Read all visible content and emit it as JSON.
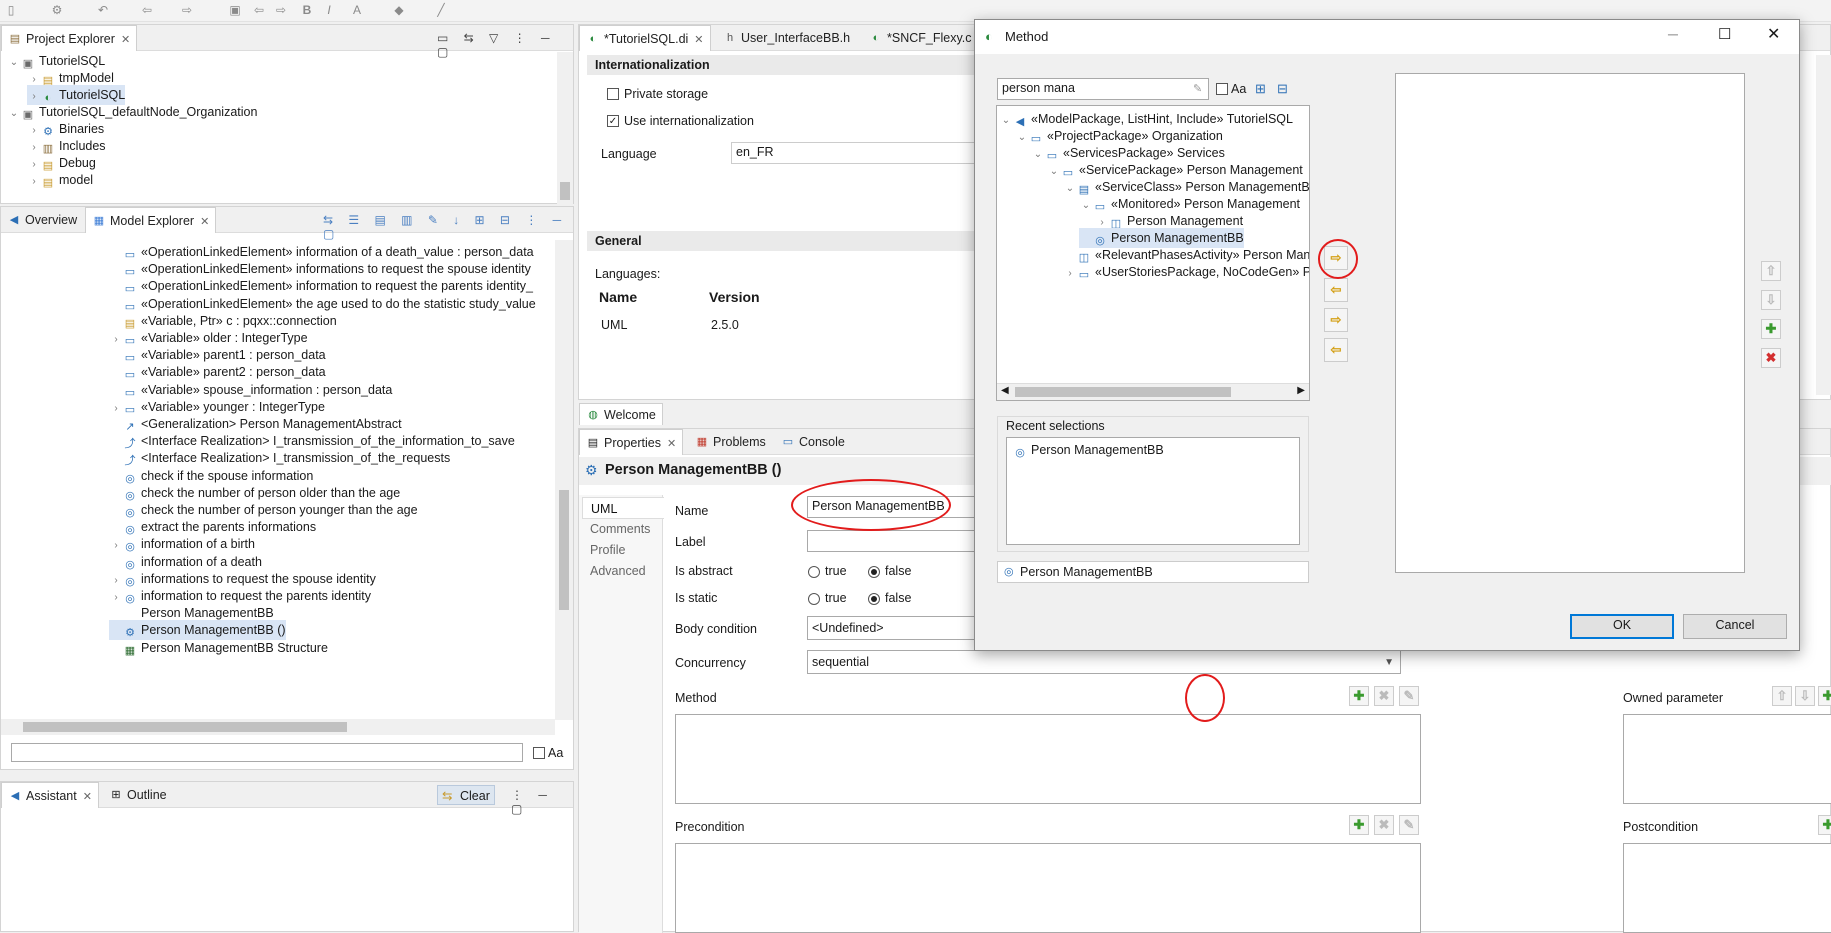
{
  "project_explorer": {
    "tab_label": "Project Explorer",
    "tree": [
      {
        "label": "TutorielSQL",
        "depth": 0,
        "twisty": "expanded",
        "icon": "project-icon"
      },
      {
        "label": "tmpModel",
        "depth": 1,
        "twisty": "collapsed",
        "icon": "folder-icon"
      },
      {
        "label": "TutorielSQL",
        "depth": 1,
        "twisty": "collapsed",
        "icon": "model-icon",
        "selected": true
      },
      {
        "label": "TutorielSQL_defaultNode_Organization",
        "depth": 0,
        "twisty": "expanded",
        "icon": "project-icon"
      },
      {
        "label": "Binaries",
        "depth": 1,
        "twisty": "collapsed",
        "icon": "binaries-icon"
      },
      {
        "label": "Includes",
        "depth": 1,
        "twisty": "collapsed",
        "icon": "includes-icon"
      },
      {
        "label": "Debug",
        "depth": 1,
        "twisty": "collapsed",
        "icon": "folder-icon"
      },
      {
        "label": "model",
        "depth": 1,
        "twisty": "collapsed",
        "icon": "folder-icon"
      }
    ]
  },
  "model_explorer": {
    "tabs": [
      "Overview",
      "Model Explorer"
    ],
    "filter_placeholder": "",
    "match_case_label": "Aa",
    "items": [
      {
        "label": "«OperationLinkedElement» information of a death_value : person_data",
        "icon": "operation-icon",
        "twisty": ""
      },
      {
        "label": "«OperationLinkedElement» informations to request the spouse identity",
        "icon": "operation-icon",
        "twisty": ""
      },
      {
        "label": "«OperationLinkedElement» information to request the parents identity_",
        "icon": "operation-icon",
        "twisty": ""
      },
      {
        "label": "«OperationLinkedElement» the age used to do the statistic study_value",
        "icon": "operation-icon",
        "twisty": ""
      },
      {
        "label": "«Variable, Ptr» c : pqxx::connection",
        "icon": "variable-icon",
        "twisty": ""
      },
      {
        "label": "«Variable» older : IntegerType",
        "icon": "operation-icon",
        "twisty": "collapsed"
      },
      {
        "label": "«Variable» parent1 : person_data",
        "icon": "operation-icon",
        "twisty": ""
      },
      {
        "label": "«Variable» parent2 : person_data",
        "icon": "operation-icon",
        "twisty": ""
      },
      {
        "label": "«Variable» spouse_information : person_data",
        "icon": "operation-icon",
        "twisty": ""
      },
      {
        "label": "«Variable» younger : IntegerType",
        "icon": "operation-icon",
        "twisty": "collapsed"
      },
      {
        "label": "<Generalization> Person ManagementAbstract",
        "icon": "generalization-icon",
        "twisty": ""
      },
      {
        "label": "<Interface Realization> I_transmission_of_the_information_to_save",
        "icon": "realization-icon",
        "twisty": ""
      },
      {
        "label": "<Interface Realization> I_transmission_of_the_requests",
        "icon": "realization-icon",
        "twisty": ""
      },
      {
        "label": "check if the spouse information",
        "icon": "behavior-icon",
        "twisty": ""
      },
      {
        "label": "check the number of person older than the age",
        "icon": "behavior-icon",
        "twisty": ""
      },
      {
        "label": "check the number of person younger than the age",
        "icon": "behavior-icon",
        "twisty": ""
      },
      {
        "label": "extract the parents informations",
        "icon": "behavior-icon",
        "twisty": ""
      },
      {
        "label": "information of a birth",
        "icon": "behavior-icon",
        "twisty": "collapsed"
      },
      {
        "label": "information of a death",
        "icon": "behavior-icon",
        "twisty": ""
      },
      {
        "label": "informations to request the spouse identity",
        "icon": "behavior-icon",
        "twisty": "collapsed"
      },
      {
        "label": "information to request the parents identity",
        "icon": "behavior-icon",
        "twisty": "collapsed"
      },
      {
        "label": "Person ManagementBB",
        "icon": "none",
        "twisty": ""
      },
      {
        "label": "Person ManagementBB ()",
        "icon": "operation-gear-icon",
        "twisty": "",
        "selected": true
      },
      {
        "label": "Person ManagementBB Structure",
        "icon": "structure-icon",
        "twisty": ""
      }
    ]
  },
  "assistant": {
    "tabs": [
      "Assistant",
      "Outline"
    ],
    "clear_label": "Clear"
  },
  "editor": {
    "tabs": [
      "*TutorielSQL.di",
      "User_InterfaceBB.h",
      "*SNCF_Flexy.c"
    ],
    "internationalization_header": "Internationalization",
    "private_storage_label": "Private storage",
    "use_i18n_label": "Use internationalization",
    "language_label": "Language",
    "language_value": "en_FR",
    "general_header": "General",
    "languages_label": "Languages:",
    "table_headers": [
      "Name",
      "Version"
    ],
    "table_rows": [
      [
        "UML",
        "2.5.0"
      ]
    ],
    "welcome_tab": "Welcome"
  },
  "properties": {
    "tabs": [
      "Properties",
      "Problems",
      "Console"
    ],
    "title": "Person ManagementBB ()",
    "side_tabs": [
      "UML",
      "Comments",
      "Profile",
      "Advanced"
    ],
    "name_label": "Name",
    "name_value": "Person ManagementBB",
    "label_label": "Label",
    "label_value": "",
    "is_abstract_label": "Is abstract",
    "is_static_label": "Is static",
    "true_label": "true",
    "false_label": "false",
    "body_condition_label": "Body condition",
    "body_condition_value": "<Undefined>",
    "concurrency_label": "Concurrency",
    "concurrency_value": "sequential",
    "method_label": "Method",
    "owned_parameter_label": "Owned parameter",
    "precondition_label": "Precondition",
    "postcondition_label": "Postcondition"
  },
  "dialog": {
    "title": "Method",
    "search_value": "person mana",
    "match_case_label": "Aa",
    "tree": [
      {
        "label": "«ModelPackage, ListHint, Include» TutorielSQL",
        "depth": 0,
        "twisty": "expanded",
        "icon": "model-package-icon"
      },
      {
        "label": "«ProjectPackage» Organization",
        "depth": 1,
        "twisty": "expanded",
        "icon": "package-icon"
      },
      {
        "label": "«ServicesPackage» Services",
        "depth": 2,
        "twisty": "expanded",
        "icon": "package-icon"
      },
      {
        "label": "«ServicePackage» Person Management",
        "depth": 3,
        "twisty": "expanded",
        "icon": "package-icon"
      },
      {
        "label": "«ServiceClass» Person ManagementBB",
        "depth": 4,
        "twisty": "expanded",
        "icon": "class-icon"
      },
      {
        "label": "«Monitored» Person Management",
        "depth": 5,
        "twisty": "expanded",
        "icon": "monitored-icon"
      },
      {
        "label": "Person Management",
        "depth": 6,
        "twisty": "collapsed",
        "icon": "interface-icon"
      },
      {
        "label": "Person ManagementBB",
        "depth": 5,
        "twisty": "",
        "icon": "behavior-icon",
        "selected": true
      },
      {
        "label": "«RelevantPhasesActivity» Person Mana",
        "depth": 4,
        "twisty": "",
        "icon": "activity-icon"
      },
      {
        "label": "«UserStoriesPackage, NoCodeGen» P",
        "depth": 4,
        "twisty": "collapsed",
        "icon": "package-icon"
      }
    ],
    "recent_label": "Recent selections",
    "recent_items": [
      "Person ManagementBB"
    ],
    "status_value": "Person ManagementBB",
    "ok_label": "OK",
    "cancel_label": "Cancel"
  },
  "colors": {
    "accent": "#0078d7",
    "highlight_circle": "#e21b1b",
    "selection": "#d9e5f5"
  }
}
